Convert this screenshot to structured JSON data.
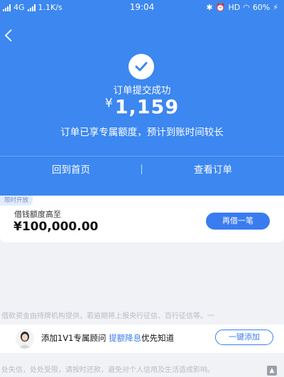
{
  "status_bar": {
    "left_text": "4G",
    "speed": "1.1K/s",
    "time": "19:04",
    "hd": "HD",
    "battery": "60%"
  },
  "header": {
    "success_title": "订单提交成功",
    "currency": "¥",
    "amount": "1,159",
    "notice": "订单已享专属额度，预计到账时间较长"
  },
  "nav": {
    "home_label": "回到首页",
    "order_label": "查看订单"
  },
  "card": {
    "tag": "限时开放",
    "label": "借钱额度高至",
    "amount": "¥100,000.00",
    "button": "再借一笔"
  },
  "disclaimer": {
    "line1": "借款资金由持牌机构提供，若逾期将上报央行征信、百行征信等。一",
    "line2": "处失信，处处受限，请按时还款，避免对个人信用及生活造成影响。"
  },
  "advisor": {
    "text_prefix": "添加1V1专属顾问 ",
    "text_highlight": "提额降息",
    "text_suffix": "优先知道",
    "button": "一键添加"
  },
  "colors": {
    "primary": "#3c87f0",
    "button": "#3a7cf0"
  }
}
